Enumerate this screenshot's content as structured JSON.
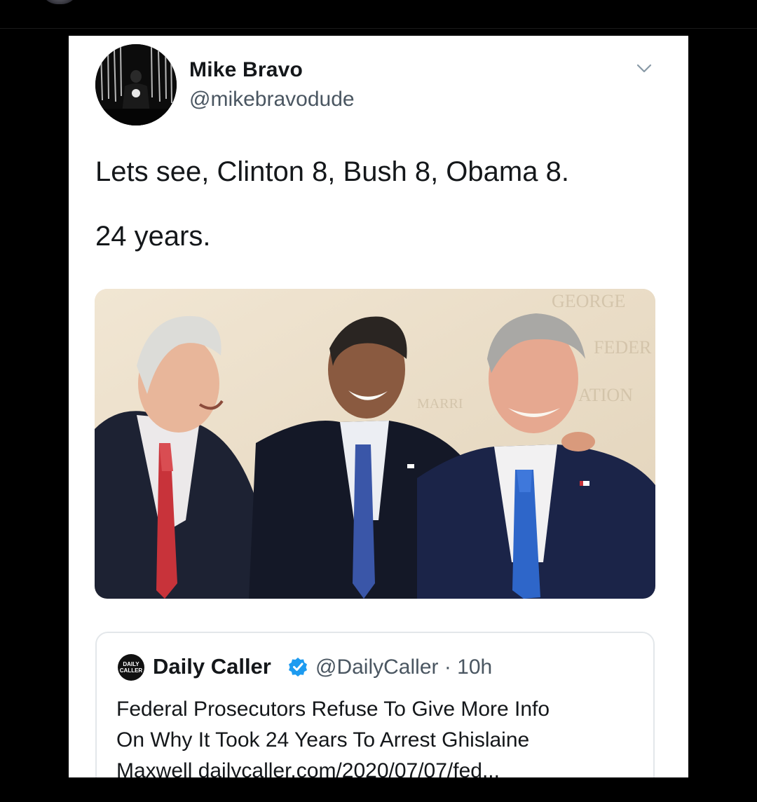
{
  "tweet": {
    "author_name": "Mike Bravo",
    "author_handle": "@mikebravodude",
    "text_line1": "Lets see, Clinton 8, Bush 8, Obama 8.",
    "text_line2": "24 years.",
    "menu_icon": "chevron-down-icon",
    "photo_background_text": [
      "GEORGE",
      "FEDER",
      "ATION",
      "MARRI"
    ]
  },
  "quoted_tweet": {
    "logo_text_line1": "DAILY",
    "logo_text_line2": "CALLER",
    "name": "Daily Caller",
    "verified_icon": "verified-badge-icon",
    "handle_time": "@DailyCaller · 10h",
    "text_line1": "Federal Prosecutors Refuse To Give More Info",
    "text_line2": "On Why It Took 24 Years To Arrest Ghislaine",
    "text_line3": "Maxwell  dailycaller.com/2020/07/07/fed..."
  },
  "colors": {
    "background": "#000000",
    "card": "#ffffff",
    "text_primary": "#14171a",
    "text_secondary": "#4a5661",
    "verified_blue": "#1d9bf0",
    "quote_border": "#e3e7ea"
  }
}
